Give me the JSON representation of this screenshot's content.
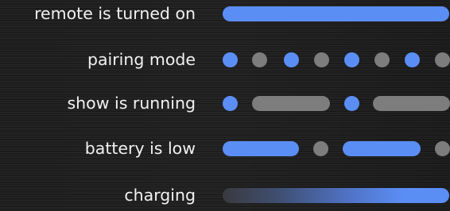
{
  "legend": {
    "rows": [
      {
        "label": "remote is turned on"
      },
      {
        "label": "pairing mode"
      },
      {
        "label": "show is running"
      },
      {
        "label": "battery is low"
      },
      {
        "label": "charging"
      }
    ]
  },
  "colors": {
    "background": "#1c1c1c",
    "active_blue": "#5b8ef5",
    "inactive_gray": "#7d7d7d",
    "label_text": "#f2f2f2"
  },
  "icons": {
    "indicator_shapes": [
      "solid-bar",
      "dot",
      "pill",
      "gradient-bar"
    ]
  }
}
